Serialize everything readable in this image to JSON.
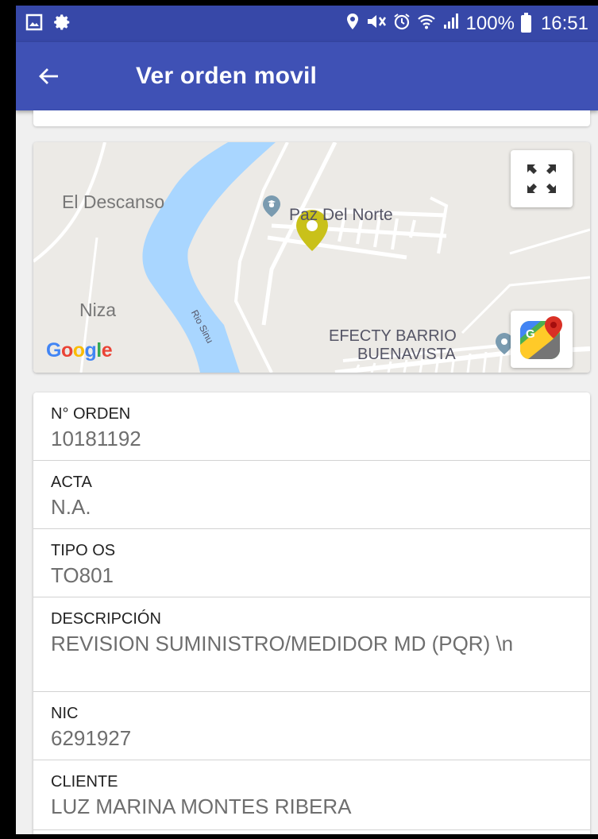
{
  "status_bar": {
    "battery": "100%",
    "time": "16:51"
  },
  "app_bar": {
    "title": "Ver orden movil"
  },
  "map": {
    "labels": {
      "el_descanso": "El Descanso",
      "paz_del_norte": "Paz Del Norte",
      "niza": "Niza",
      "rio_sinu": "Rio Sinu",
      "efecty_line1": "EFECTY BARRIO",
      "efecty_line2": "BUENAVISTA"
    },
    "google_logo": "Google",
    "colors": {
      "land": "#eceae6",
      "river": "#a9d6ff",
      "road": "#ffffff",
      "marker": "#c9c11a",
      "poi": "#7a9bb0"
    }
  },
  "details": [
    {
      "label": "N° ORDEN",
      "value": "10181192"
    },
    {
      "label": "ACTA",
      "value": "N.A."
    },
    {
      "label": "TIPO OS",
      "value": "TO801"
    },
    {
      "label": "DESCRIPCIÓN",
      "value": "REVISION SUMINISTRO/MEDIDOR MD (PQR) \\n"
    },
    {
      "label": "NIC",
      "value": "6291927"
    },
    {
      "label": "CLIENTE",
      "value": "LUZ MARINA MONTES RIBERA"
    }
  ],
  "theme": {
    "primary": "#3f51b5",
    "primary_dark": "#3748a8"
  }
}
